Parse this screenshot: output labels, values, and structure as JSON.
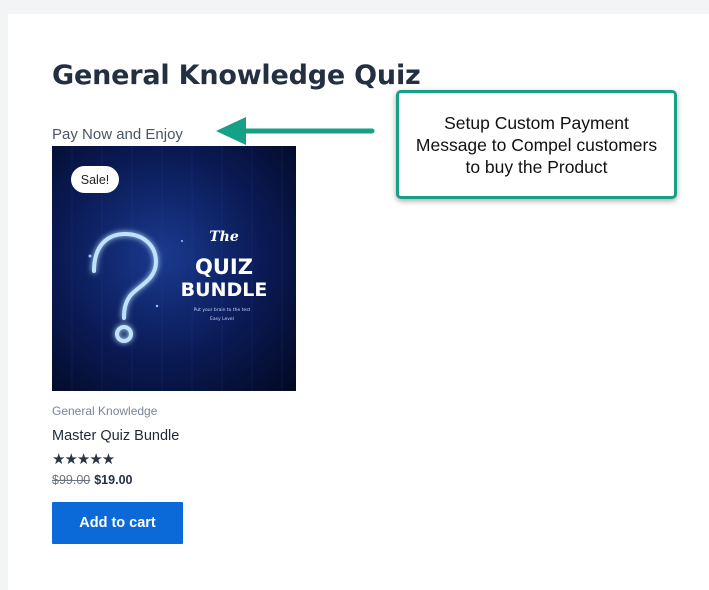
{
  "page": {
    "title": "General Knowledge Quiz",
    "payment_message": "Pay Now and Enjoy"
  },
  "callout": {
    "text": "Setup Custom Payment Message to Compel customers to buy the Product",
    "border_color": "#16a085"
  },
  "product": {
    "badge": "Sale!",
    "image": {
      "script_word": "The",
      "title_line1": "QUIZ",
      "title_line2": "BUNDLE",
      "subline1": "Put your brain to the test",
      "subline2": "Easy Level"
    },
    "category": "General Knowledge",
    "name": "Master Quiz Bundle",
    "rating": 5,
    "rating_max": 5,
    "stars": "★★★★★",
    "old_price": "$99.00",
    "price": "$19.00",
    "button_label": "Add to cart",
    "button_color": "#0b6ad8"
  }
}
